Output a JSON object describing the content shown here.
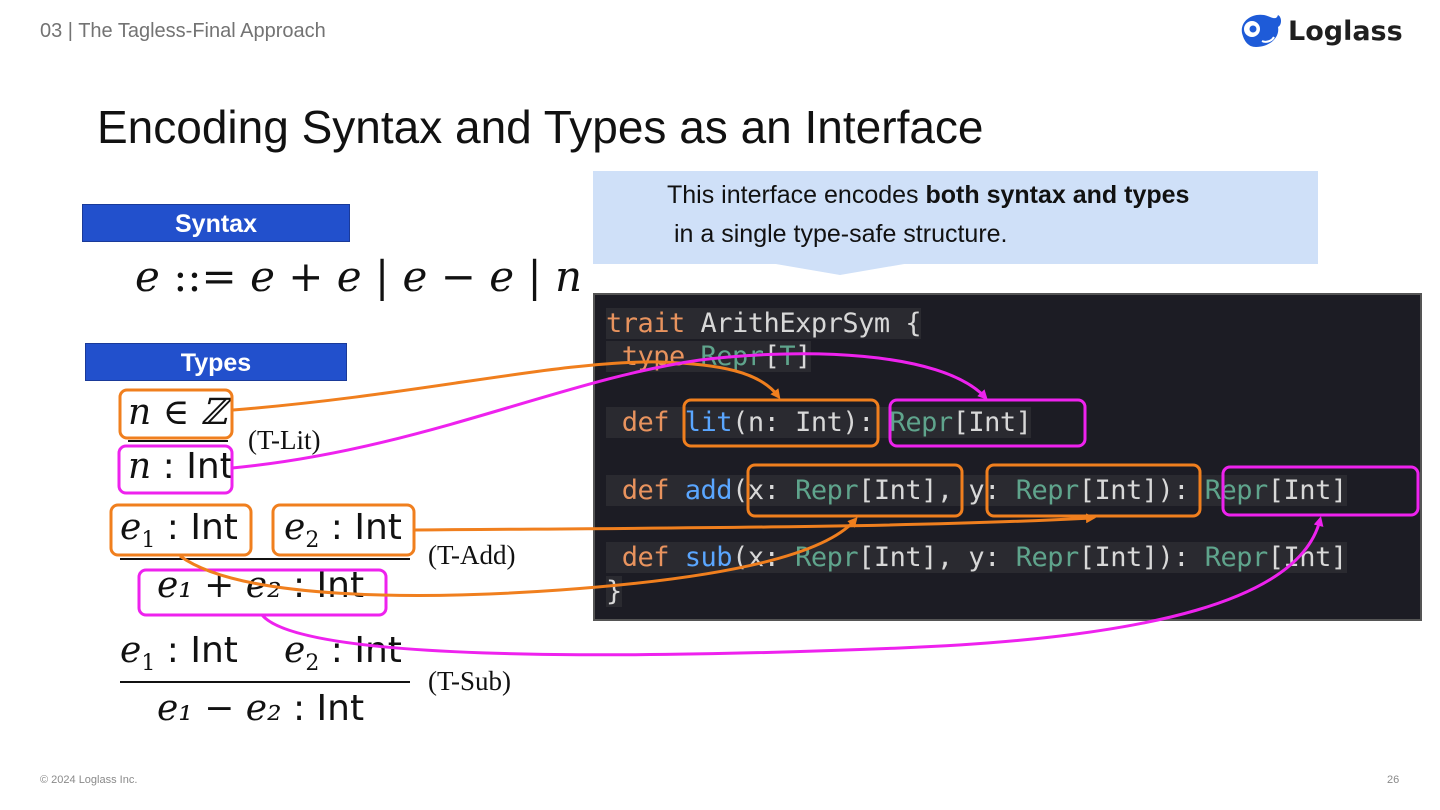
{
  "header": {
    "section": "03 | The Tagless-Final Approach",
    "logo_text": "Loglass",
    "logo_icon": "whale-icon"
  },
  "slide": {
    "title": "Encoding Syntax and Types as an Interface"
  },
  "syntax": {
    "label": "Syntax",
    "grammar": {
      "var": "e",
      "def": " ::= ",
      "alt1": "e + e",
      "sep": " | ",
      "alt2": "e − e",
      "alt3": "n"
    }
  },
  "types": {
    "label": "Types",
    "rules": [
      {
        "name": "(T-Lit)",
        "premise": "n ∈ ℤ",
        "conclusion_var": "n",
        "conclusion_type": " : Int"
      },
      {
        "name": "(T-Add)",
        "premise1_var": "e",
        "premise1_sub": "1",
        "premise2_var": "e",
        "premise2_sub": "2",
        "type": " : Int",
        "conclusion": "e₁ + e₂"
      },
      {
        "name": "(T-Sub)",
        "premise1_var": "e",
        "premise1_sub": "1",
        "premise2_var": "e",
        "premise2_sub": "2",
        "type": " : Int",
        "conclusion": "e₁ − e₂"
      }
    ]
  },
  "callout": {
    "line1_prefix": "This interface encodes ",
    "line1_bold": "both syntax and types",
    "line2": "in a single type-safe structure."
  },
  "code": {
    "lines": [
      {
        "kw": "trait",
        "rest": " ArithExprSym {"
      },
      {
        "kw": " type",
        "ty": " Repr",
        "rest": "[",
        "ty2": "T",
        "rest2": "]"
      },
      {
        "kw": " def",
        "fn": " lit",
        "rest": "(n: Int): ",
        "ty": "Repr",
        "rest2": "[Int]"
      },
      {
        "kw": " def",
        "fn": " add",
        "rest": "(x: ",
        "ty": "Repr",
        "rest2": "[Int], y: ",
        "ty2": "Repr",
        "rest3": "[Int]): ",
        "ty3": "Repr",
        "rest4": "[Int]"
      },
      {
        "kw": " def",
        "fn": " sub",
        "rest": "(x: ",
        "ty": "Repr",
        "rest2": "[Int], y: ",
        "ty2": "Repr",
        "rest3": "[Int]): ",
        "ty3": "Repr",
        "rest4": "[Int]"
      },
      {
        "rest": "}"
      }
    ]
  },
  "colors": {
    "orange": "#f07f1e",
    "magenta": "#ee22ee",
    "label_bg": "#2250cc",
    "callout_bg": "#cfe0f8",
    "code_bg": "#1c1c24"
  },
  "footer": {
    "copyright": "© 2024 Loglass Inc.",
    "page_number": "26"
  }
}
